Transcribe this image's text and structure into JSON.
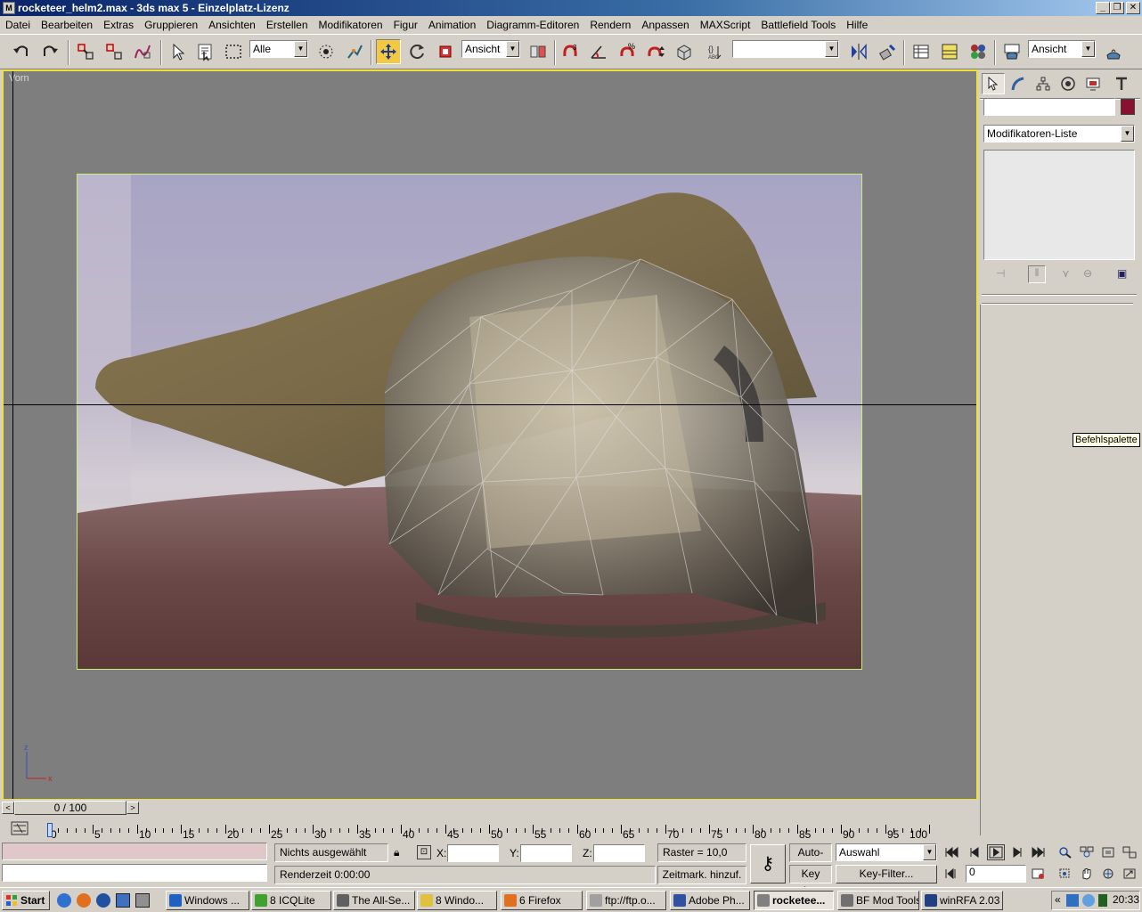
{
  "window": {
    "title": "rocketeer_helm2.max - 3ds max 5 - Einzelplatz-Lizenz"
  },
  "menu": [
    "Datei",
    "Bearbeiten",
    "Extras",
    "Gruppieren",
    "Ansichten",
    "Erstellen",
    "Modifikatoren",
    "Figur",
    "Animation",
    "Diagramm-Editoren",
    "Rendern",
    "Anpassen",
    "MAXScript",
    "Battlefield Tools",
    "Hilfe"
  ],
  "toolbar": {
    "selection_filter": "Alle",
    "coord_system": "Ansicht",
    "named_selection": "",
    "render_view": "Ansicht",
    "snap_label": "3",
    "percent_label": "%"
  },
  "viewport": {
    "label": "Vorn",
    "axis_z": "z",
    "axis_x": "x"
  },
  "command_panel": {
    "name_value": "",
    "modifier_list": "Modifikatoren-Liste",
    "tooltip": "Befehlspalette"
  },
  "timeline": {
    "frame_readout": "0 / 100",
    "ticks": [
      "0",
      "5",
      "10",
      "15",
      "20",
      "25",
      "30",
      "35",
      "40",
      "45",
      "50",
      "55",
      "60",
      "65",
      "70",
      "75",
      "80",
      "85",
      "90",
      "95",
      "100"
    ]
  },
  "status": {
    "selection": "Nichts ausgewählt",
    "render_time": "Renderzeit  0:00:00",
    "x_label": "X:",
    "y_label": "Y:",
    "z_label": "Z:",
    "grid": "Raster = 10,0",
    "time_tag": "Zeitmark. hinzuf.",
    "auto_key": "Auto-Key",
    "set_key": "Key einst.",
    "key_filter": "Key-Filter...",
    "key_mode": "Auswahl",
    "current_frame": "0"
  },
  "taskbar": {
    "start": "Start",
    "tasks": [
      {
        "label": "Windows ...",
        "color": "#2060c0"
      },
      {
        "label": "8 ICQLite",
        "color": "#40a030"
      },
      {
        "label": "The All-Se...",
        "color": "#606060"
      },
      {
        "label": "8 Windo...",
        "color": "#e0c040"
      },
      {
        "label": "6 Firefox",
        "color": "#e07020"
      },
      {
        "label": "ftp://ftp.o...",
        "color": "#a0a0a0"
      },
      {
        "label": "Adobe Ph...",
        "color": "#3050a0"
      },
      {
        "label": "rocketee...",
        "color": "#808080"
      },
      {
        "label": "BF Mod Tools",
        "color": "#707070"
      },
      {
        "label": "winRFA 2.03",
        "color": "#204080"
      }
    ],
    "clock": "20:33"
  }
}
